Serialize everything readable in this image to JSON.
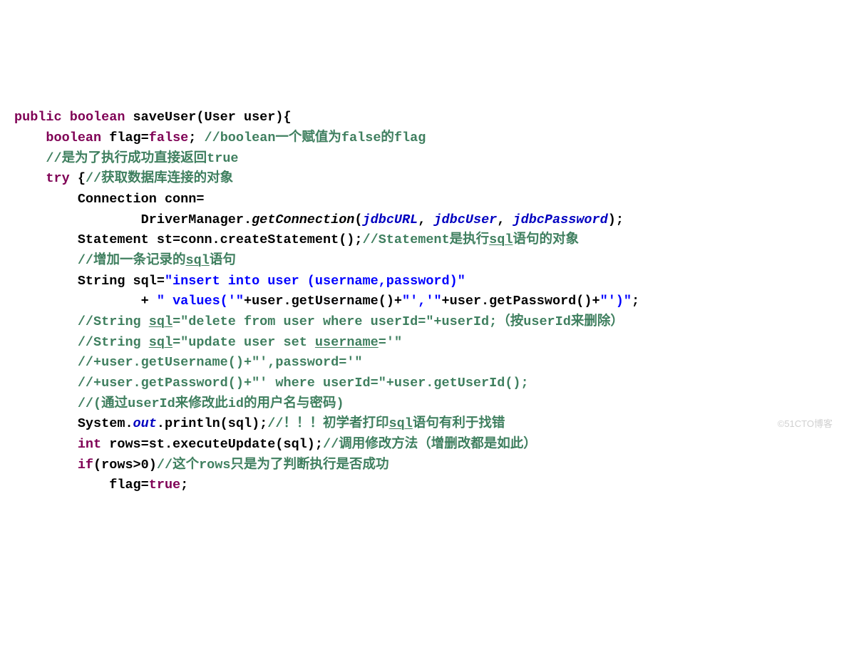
{
  "watermark": "©51CTO博客",
  "code": {
    "l01": {
      "a": "public",
      "b": " ",
      "c": "boolean",
      "d": " saveUser(User user){"
    },
    "l02": {
      "pad": "    ",
      "a": "boolean",
      "b": " flag=",
      "c": "false",
      "d": "; ",
      "e": "//boolean一个赋值为false的flag"
    },
    "l03": {
      "pad": "    ",
      "a": "//是为了执行成功直接返回true"
    },
    "l04": {
      "pad": "    ",
      "a": "try",
      "b": " {",
      "c": "//获取数据库连接的对象"
    },
    "l05": {
      "pad": "        ",
      "a": "Connection conn="
    },
    "l06": {
      "pad": "                ",
      "a": "DriverManager.",
      "b": "getConnection",
      "c": "(",
      "d": "jdbcURL",
      "e": ", ",
      "f": "jdbcUser",
      "g": ", ",
      "h": "jdbcPassword",
      "i": ");"
    },
    "l07": {
      "pad": "        ",
      "a": "Statement st=conn.createStatement();",
      "b": "//Statement是执行",
      "c": "sql",
      "d": "语句的对象"
    },
    "l08": {
      "pad": "        ",
      "a": "//增加一条记录的",
      "b": "sql",
      "c": "语句"
    },
    "l09": {
      "pad": "        ",
      "a": "String sql=",
      "b": "\"insert into user (username,password)\""
    },
    "l10": {
      "pad": "                ",
      "a": "+ ",
      "b": "\" values('\"",
      "c": "+user.getUsername()+",
      "d": "\"','\"",
      "e": "+user.getPassword()+",
      "f": "\"')\"",
      "g": ";"
    },
    "l11": {
      "pad": "        ",
      "a": "//String ",
      "b": "sql",
      "c": "=\"delete from user where userId=\"+userId;（按userId来删除）"
    },
    "l12": {
      "pad": "        ",
      "a": "//String ",
      "b": "sql",
      "c": "=\"update user set ",
      "d": "username",
      "e": "='\""
    },
    "l13": {
      "pad": "        ",
      "a": "//+user.getUsername()+\"',password='\""
    },
    "l14": {
      "pad": "        ",
      "a": "//+user.getPassword()+\"' where userId=\"+user.getUserId();"
    },
    "l15": {
      "pad": "        ",
      "a": "//(通过userId来修改此id的用户名与密码)"
    },
    "l16": {
      "pad": "        ",
      "a": "System.",
      "b": "out",
      "c": ".println(sql);",
      "d": "//！！！初学者打印",
      "e": "sql",
      "f": "语句有利于找错"
    },
    "l17": {
      "pad": "        ",
      "a": "int",
      "b": " rows=st.executeUpdate(sql);",
      "c": "//调用修改方法（增删改都是如此）"
    },
    "l18": {
      "pad": "        ",
      "a": "if",
      "b": "(rows>0)",
      "c": "//这个rows只是为了判断执行是否成功"
    },
    "l19": {
      "pad": "            ",
      "a": "flag=",
      "b": "true",
      "c": ";"
    }
  }
}
